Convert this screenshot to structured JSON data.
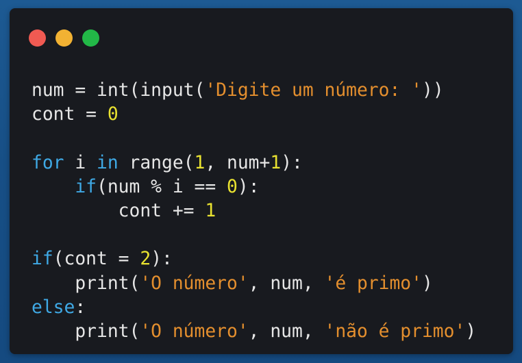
{
  "window": {
    "controls": [
      {
        "name": "close-dot",
        "color": "#f05a52"
      },
      {
        "name": "minimize-dot",
        "color": "#f2b233"
      },
      {
        "name": "zoom-dot",
        "color": "#22b847"
      }
    ]
  },
  "colors": {
    "keyword": "#3fa9e5",
    "string": "#e48f2e",
    "number": "#e9e230",
    "text": "#e6e6e6",
    "editor_background": "#181a1f"
  },
  "code": {
    "lines": [
      [
        {
          "t": "num = int(input(",
          "c": "plain"
        },
        {
          "t": "'Digite um número: '",
          "c": "str"
        },
        {
          "t": "))",
          "c": "plain"
        }
      ],
      [
        {
          "t": "cont = ",
          "c": "plain"
        },
        {
          "t": "0",
          "c": "num"
        }
      ],
      [],
      [
        {
          "t": "for",
          "c": "kw"
        },
        {
          "t": " i ",
          "c": "plain"
        },
        {
          "t": "in",
          "c": "kw"
        },
        {
          "t": " range(",
          "c": "plain"
        },
        {
          "t": "1",
          "c": "num"
        },
        {
          "t": ", num+",
          "c": "plain"
        },
        {
          "t": "1",
          "c": "num"
        },
        {
          "t": "):",
          "c": "plain"
        }
      ],
      [
        {
          "t": "    ",
          "c": "plain"
        },
        {
          "t": "if",
          "c": "kw"
        },
        {
          "t": "(num % i == ",
          "c": "plain"
        },
        {
          "t": "0",
          "c": "num"
        },
        {
          "t": "):",
          "c": "plain"
        }
      ],
      [
        {
          "t": "        cont += ",
          "c": "plain"
        },
        {
          "t": "1",
          "c": "num"
        }
      ],
      [],
      [
        {
          "t": "if",
          "c": "kw"
        },
        {
          "t": "(cont = ",
          "c": "plain"
        },
        {
          "t": "2",
          "c": "num"
        },
        {
          "t": "):",
          "c": "plain"
        }
      ],
      [
        {
          "t": "    print(",
          "c": "plain"
        },
        {
          "t": "'O número'",
          "c": "str"
        },
        {
          "t": ", num, ",
          "c": "plain"
        },
        {
          "t": "'é primo'",
          "c": "str"
        },
        {
          "t": ")",
          "c": "plain"
        }
      ],
      [
        {
          "t": "else",
          "c": "kw"
        },
        {
          "t": ":",
          "c": "plain"
        }
      ],
      [
        {
          "t": "    print(",
          "c": "plain"
        },
        {
          "t": "'O número'",
          "c": "str"
        },
        {
          "t": ", num, ",
          "c": "plain"
        },
        {
          "t": "'não é primo'",
          "c": "str"
        },
        {
          "t": ")",
          "c": "plain"
        }
      ]
    ]
  }
}
